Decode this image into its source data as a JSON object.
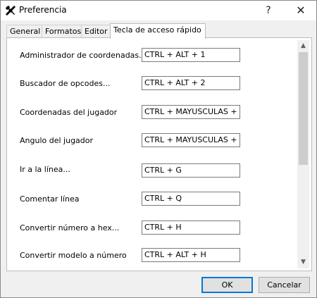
{
  "window": {
    "title": "Preferencia",
    "help_label": "?",
    "close_label": "✕",
    "app_icon": "tools-icon"
  },
  "tabs": [
    {
      "label": "General",
      "active": false
    },
    {
      "label": "Formatos",
      "active": false
    },
    {
      "label": "Editor",
      "active": false
    },
    {
      "label": "Tecla de acceso rápido",
      "active": true
    }
  ],
  "shortcuts": [
    {
      "label": "Administrador de coordenadas...",
      "value": "CTRL + ALT + 1"
    },
    {
      "label": "Buscador de opcodes...",
      "value": "CTRL + ALT + 2"
    },
    {
      "label": "Coordenadas del jugador",
      "value": "CTRL + MAYUSCULAS + C"
    },
    {
      "label": "Angulo del jugador",
      "value": "CTRL + MAYUSCULAS + E"
    },
    {
      "label": "Ir a la línea...",
      "value": "CTRL + G"
    },
    {
      "label": "Comentar línea",
      "value": "CTRL + Q"
    },
    {
      "label": "Convertir número a hex...",
      "value": "CTRL + H"
    },
    {
      "label": "Convertir modelo a número",
      "value": "CTRL + ALT + H"
    }
  ],
  "scrollbar": {
    "up": "▲",
    "down": "▼"
  },
  "buttons": {
    "ok": "OK",
    "cancel": "Cancelar"
  }
}
